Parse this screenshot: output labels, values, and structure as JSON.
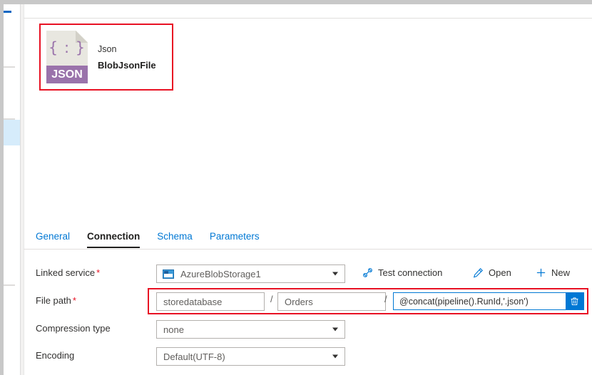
{
  "window": {
    "left_rail": {
      "selected_item": "rail-selected-item"
    }
  },
  "dataset_header": {
    "icon_label": "JSON",
    "icon_braces": "{ : }",
    "type": "Json",
    "name": "BlobJsonFile"
  },
  "tabs": [
    {
      "label": "General",
      "active": false
    },
    {
      "label": "Connection",
      "active": true
    },
    {
      "label": "Schema",
      "active": false
    },
    {
      "label": "Parameters",
      "active": false
    }
  ],
  "form": {
    "linked_service": {
      "label": "Linked service",
      "required": "*",
      "value": "AzureBlobStorage1",
      "icon": "azure-blob-storage-icon",
      "actions": [
        {
          "label": "Test connection",
          "icon": "plug-icon"
        },
        {
          "label": "Open",
          "icon": "pencil-icon"
        },
        {
          "label": "New",
          "icon": "plus-icon"
        }
      ]
    },
    "file_path": {
      "label": "File path",
      "required": "*",
      "container": "storedatabase",
      "directory": "Orders",
      "separator": "/",
      "file_name_expression": "@concat(pipeline().RunId,'.json')",
      "delete_icon": "trash-icon"
    },
    "compression_type": {
      "label": "Compression type",
      "value": "none"
    },
    "encoding": {
      "label": "Encoding",
      "value": "Default(UTF-8)"
    }
  },
  "colors": {
    "accent": "#0078d4",
    "highlight_box": "#e81123",
    "json_purple": "#9a73ab",
    "selected_rail": "#d6ecfb"
  }
}
